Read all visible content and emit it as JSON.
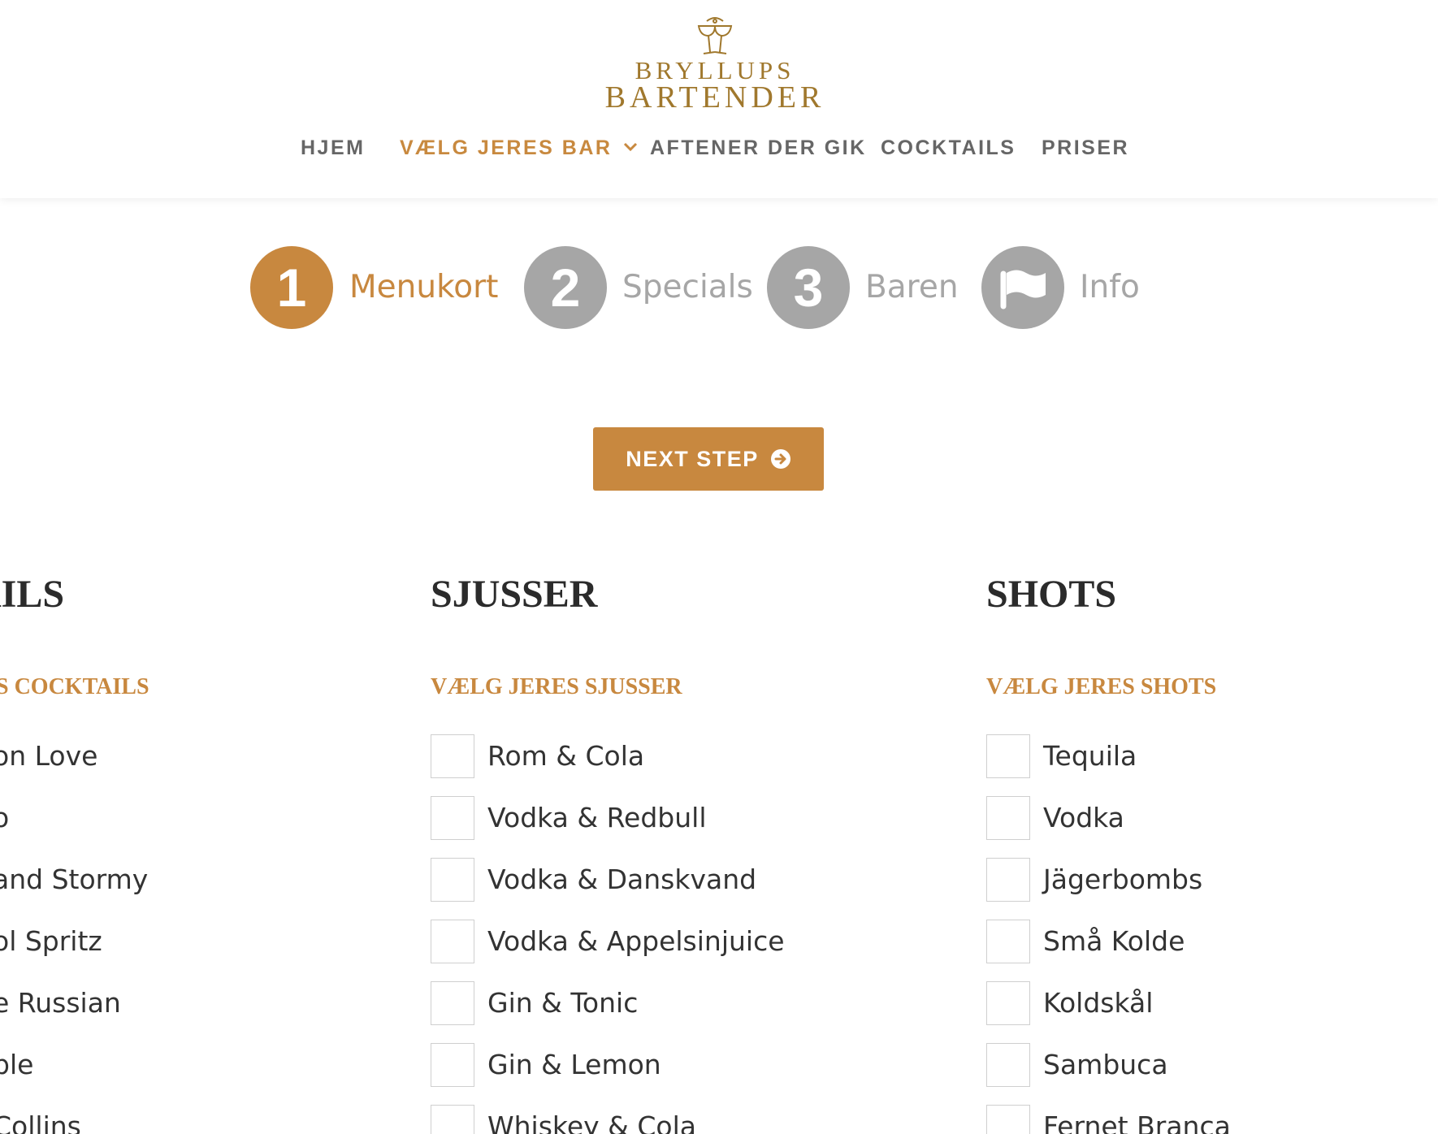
{
  "logo": {
    "line1": "BRYLLUPS",
    "line2": "BARTENDER"
  },
  "nav": {
    "items": [
      {
        "label": "HJEM",
        "active": false
      },
      {
        "label": "VÆLG JERES BAR",
        "active": true
      },
      {
        "label": "AFTENER DER GIK",
        "active": false
      },
      {
        "label": "COCKTAILS",
        "active": false
      },
      {
        "label": "PRISER",
        "active": false
      }
    ]
  },
  "steps": [
    {
      "number": "1",
      "label": "Menukort",
      "active": true
    },
    {
      "number": "2",
      "label": "Specials",
      "active": false
    },
    {
      "number": "3",
      "label": "Baren",
      "active": false
    },
    {
      "icon": "flag-icon",
      "label": "Info",
      "active": false
    }
  ],
  "next_button": {
    "label": "NEXT STEP"
  },
  "columns": {
    "cocktails": {
      "title": "AILS",
      "subtitle": "S COCKTAILS",
      "items": [
        "on Love",
        "o",
        "and Stormy",
        "ol Spritz",
        "e Russian",
        "ble",
        "Collins"
      ]
    },
    "sjusser": {
      "title": "SJUSSER",
      "subtitle": "VÆLG JERES SJUSSER",
      "items": [
        "Rom & Cola",
        "Vodka & Redbull",
        "Vodka & Danskvand",
        "Vodka & Appelsinjuice",
        "Gin & Tonic",
        "Gin & Lemon",
        "Whiskey & Cola"
      ]
    },
    "shots": {
      "title": "SHOTS",
      "subtitle": "VÆLG JERES SHOTS",
      "items": [
        "Tequila",
        "Vodka",
        "Jägerbombs",
        "Små Kolde",
        "Koldskål",
        "Sambuca",
        "Fernet Branca"
      ]
    }
  },
  "colors": {
    "accent": "#c8883f",
    "inactive": "#a6a6a6",
    "nav": "#666666"
  }
}
